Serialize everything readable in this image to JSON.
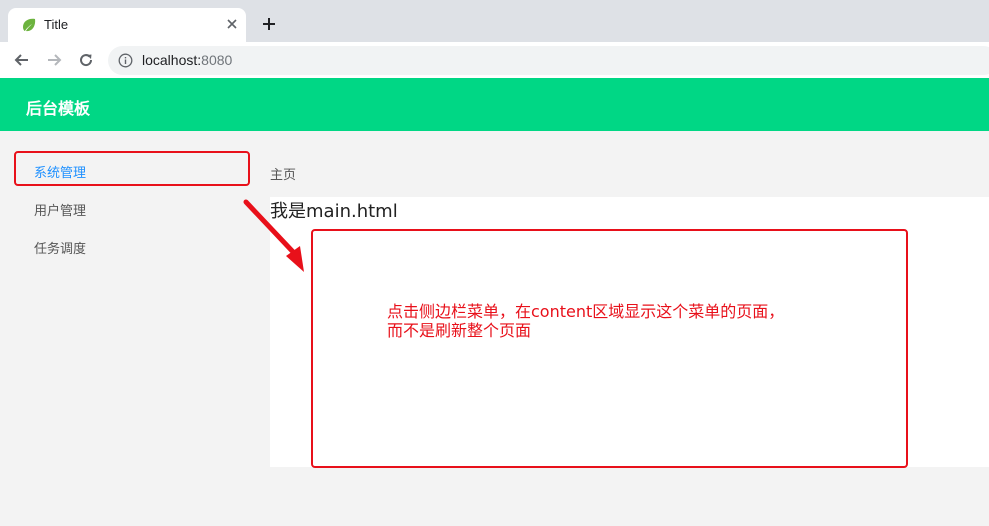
{
  "browser": {
    "tab_title": "Title",
    "url_host": "localhost:",
    "url_port": "8080"
  },
  "app": {
    "title": "后台模板"
  },
  "sidebar": {
    "items": [
      {
        "label": "系统管理"
      },
      {
        "label": "用户管理"
      },
      {
        "label": "任务调度"
      }
    ]
  },
  "main": {
    "breadcrumb": "主页",
    "content_title": "我是main.html"
  },
  "annotation": {
    "line1": "点击侧边栏菜单，在content区域显示这个菜单的页面，",
    "line2": "而不是刷新整个页面"
  },
  "colors": {
    "header": "#00d785",
    "active_menu": "#1e90ff",
    "annotation": "#e8101a"
  }
}
